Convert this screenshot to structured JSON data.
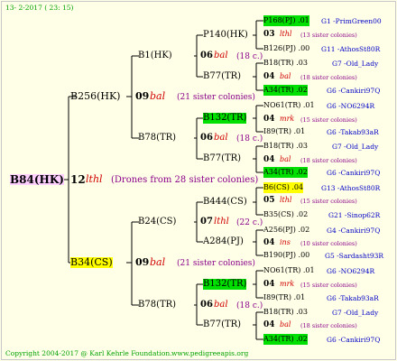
{
  "header": {
    "date": "13-  2-2017 ( 23: 15)"
  },
  "footer": {
    "copyright": "Copyright 2004-2017 @ Karl Kehrle Foundation.",
    "website": "www.pedigreeapis.org"
  },
  "root": {
    "queen": "B84(HK)",
    "year_num": "12",
    "year_suffix": "lthl",
    "note": "(Drones from 28 sister colonies)"
  },
  "gen1": [
    {
      "queen": "B256(HK)",
      "year_num": "09",
      "year_suffix": "bal",
      "sisters": "(21 sister colonies)"
    },
    {
      "queen": "B34(CS)",
      "year_num": "09",
      "year_suffix": "bal",
      "sisters": "(21 sister colonies)"
    }
  ],
  "gen2": [
    {
      "queen": "B1(HK)",
      "year_num": "06",
      "year_suffix": "bal",
      "sisters": "(18 c.)"
    },
    {
      "queen": "B78(TR)",
      "year_num": "06",
      "year_suffix": "bal",
      "sisters": "(18 c.)"
    },
    {
      "queen": "B24(CS)",
      "year_num": "07",
      "year_suffix": "lthl",
      "sisters": "(22 c.)"
    },
    {
      "queen": "B78(TR)",
      "year_num": "06",
      "year_suffix": "bal",
      "sisters": "(18 c.)"
    }
  ],
  "gen3": [
    {
      "queen": "P140(HK)"
    },
    {
      "queen": "B77(TR)"
    },
    {
      "queen": "B132(TR)"
    },
    {
      "queen": "B77(TR)"
    },
    {
      "queen": "B444(CS)"
    },
    {
      "queen": "A284(PJ)"
    },
    {
      "queen": "B132(TR)"
    },
    {
      "queen": "B77(TR)"
    }
  ],
  "gen4": [
    {
      "queen": "P168(PJ)",
      "num": ".01",
      "breeder": "G1 -PrimGreen00"
    },
    {
      "queen": "03",
      "yr": "lthl",
      "sisters": "(13 sister colonies)"
    },
    {
      "queen": "B126(PJ)",
      "num": ".00",
      "breeder": "G11 -AthosSt80R"
    },
    {
      "queen": "B18(TR)",
      "num": ".03",
      "breeder": "G7 -Old_Lady"
    },
    {
      "queen": "04",
      "yr": "bal",
      "sisters": "(18 sister colonies)"
    },
    {
      "queen": "A34(TR)",
      "num": ".02",
      "breeder": "G6 -Cankiri97Q"
    },
    {
      "queen": "NO61(TR)",
      "num": ".01",
      "breeder": "G6 -NO6294R"
    },
    {
      "queen": "04",
      "yr": "mrk",
      "sisters": "(15 sister colonies)"
    },
    {
      "queen": "I89(TR)",
      "num": ".01",
      "breeder": "G6 -Takab93aR"
    },
    {
      "queen": "B18(TR)",
      "num": ".03",
      "breeder": "G7 -Old_Lady"
    },
    {
      "queen": "04",
      "yr": "bal",
      "sisters": "(18 sister colonies)"
    },
    {
      "queen": "A34(TR)",
      "num": ".02",
      "breeder": "G6 -Cankiri97Q"
    },
    {
      "queen": "B6(CS)",
      "num": ".04",
      "breeder": "G13 -AthosSt80R"
    },
    {
      "queen": "05",
      "yr": "lthl",
      "sisters": "(15 sister colonies)"
    },
    {
      "queen": "B35(CS)",
      "num": ".02",
      "breeder": "G21 -Sinop62R"
    },
    {
      "queen": "A256(PJ)",
      "num": ".02",
      "breeder": "G4 -Cankiri97Q"
    },
    {
      "queen": "04",
      "yr": "ins",
      "sisters": "(10 sister colonies)"
    },
    {
      "queen": "B190(PJ)",
      "num": ".00",
      "breeder": "G5 -Sardasht93R"
    },
    {
      "queen": "NO61(TR)",
      "num": ".01",
      "breeder": "G6 -NO6294R"
    },
    {
      "queen": "04",
      "yr": "mrk",
      "sisters": "(15 sister colonies)"
    },
    {
      "queen": "I89(TR)",
      "num": ".01",
      "breeder": "G6 -Takab93aR"
    },
    {
      "queen": "B18(TR)",
      "num": ".03",
      "breeder": "G7 -Old_Lady"
    },
    {
      "queen": "04",
      "yr": "bal",
      "sisters": "(18 sister colonies)"
    },
    {
      "queen": "A34(TR)",
      "num": ".02",
      "breeder": "G6 -Cankiri97Q"
    }
  ],
  "colors": {
    "background": "#ffffe7",
    "highlight_green": "#00e000",
    "highlight_yellow": "#ffff00",
    "highlight_root": "#ffd0ff",
    "year_red": "#d00000",
    "sister_purple": "#8a008a",
    "breeder_blue": "#0000c8"
  }
}
